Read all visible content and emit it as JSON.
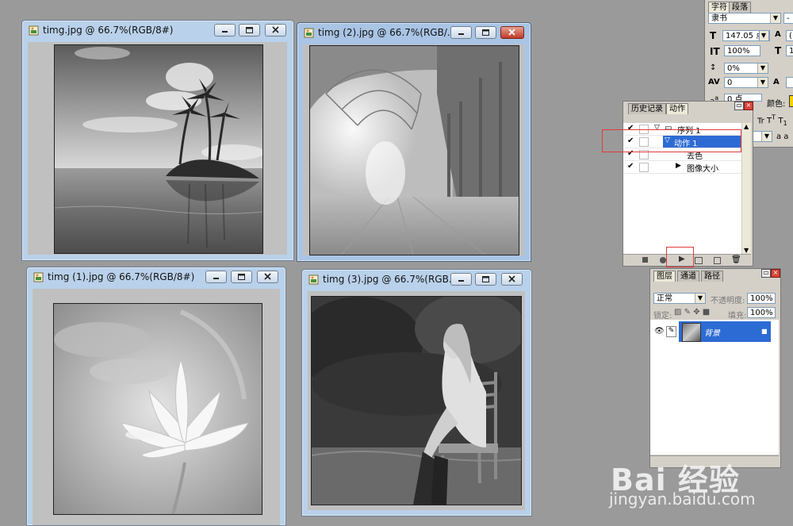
{
  "documents": [
    {
      "title": "timg.jpg @ 66.7%(RGB/8#)",
      "active": false
    },
    {
      "title": "timg (2).jpg @ 66.7%(RGB/...",
      "active": true
    },
    {
      "title": "timg (1).jpg @ 66.7%(RGB/8#)",
      "active": false
    },
    {
      "title": "timg (3).jpg @ 66.7%(RGB...",
      "active": false
    }
  ],
  "character_panel": {
    "tabs": [
      "字符",
      "段落"
    ],
    "font_family": "隶书",
    "font_size": "147.05 点",
    "vertical_scale": "100%",
    "tracking_label": "0%",
    "kerning_value": "0",
    "baseline_value": "0 点",
    "color_label": "颜色:",
    "color_swatch": "#f7d200",
    "aa_label": "a a"
  },
  "actions_panel": {
    "tabs": [
      "历史记录",
      "动作"
    ],
    "rows": [
      {
        "label": "序列 1",
        "indent": 0,
        "checked": true,
        "expanded": true,
        "folder": true
      },
      {
        "label": "动作 1",
        "indent": 1,
        "checked": true,
        "expanded": true,
        "selected": true
      },
      {
        "label": "去色",
        "indent": 2,
        "checked": true
      },
      {
        "label": "图像大小",
        "indent": 2,
        "checked": true,
        "collapsed": true
      }
    ]
  },
  "layers_panel": {
    "tabs": [
      "图层",
      "通道",
      "路径"
    ],
    "blend_mode": "正常",
    "opacity_label": "不透明度:",
    "opacity_value": "100%",
    "lock_label": "锁定:",
    "fill_label": "填充:",
    "fill_value": "100%",
    "layer_name": "背景"
  },
  "watermark": {
    "logo": "Bai 经验",
    "url": "jingyan.baidu.com"
  }
}
